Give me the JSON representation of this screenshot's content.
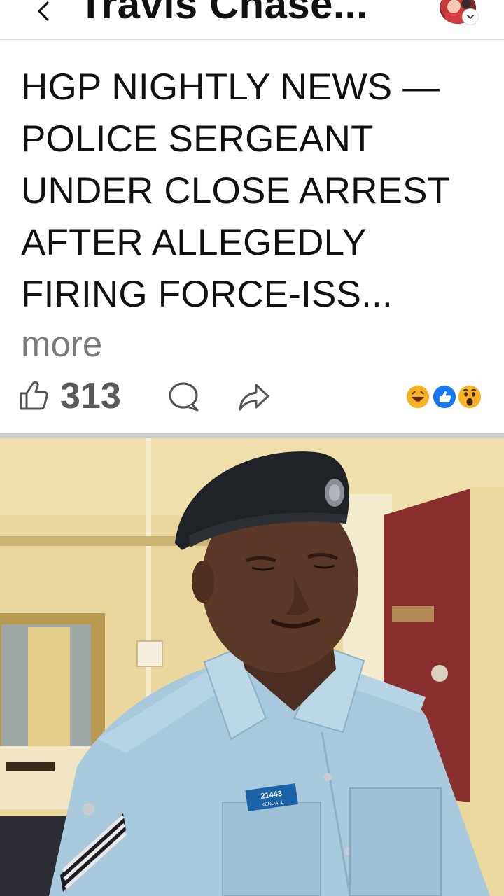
{
  "header": {
    "title": "Travis Chase...",
    "back_icon": "chevron-left-icon",
    "avatar_icon": "profile-avatar",
    "chevron_icon": "chevron-down-icon"
  },
  "post": {
    "text_lines": [
      "HGP NIGHTLY NEWS —",
      "POLICE SERGEANT",
      "UNDER CLOSE ARREST",
      "AFTER ALLEGEDLY",
      "FIRING FORCE-ISS..."
    ],
    "more_label": "more"
  },
  "actions": {
    "like_count": "313",
    "like_icon": "thumbs-up-icon",
    "comment_icon": "comment-icon",
    "share_icon": "share-arrow-icon",
    "reactions": [
      "haha-reaction",
      "like-reaction",
      "wow-reaction"
    ]
  },
  "photo": {
    "badge_number": "21443",
    "badge_name": "KENDALL"
  },
  "colors": {
    "muted_text": "#7a7a7a",
    "count_text": "#5a5a5a",
    "like_blue": "#1877f2",
    "reaction_yellow": "#f7b125",
    "uniform_blue": "#a9c9dc",
    "wall": "#e8d49a",
    "door": "#8a2f2f"
  }
}
